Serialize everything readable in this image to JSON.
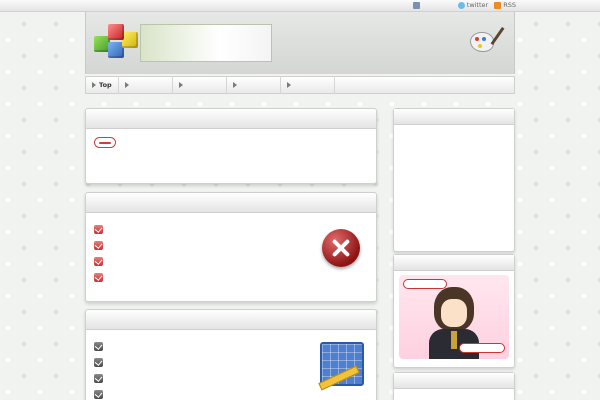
{
  "toplinks": {
    "home": "",
    "twitter": "twitter",
    "rss": "RSS"
  },
  "header": {
    "tagline": "",
    "title": "",
    "subtitle": ""
  },
  "nav": [
    {
      "label": "Top"
    },
    {
      "label": ""
    },
    {
      "label": ""
    },
    {
      "label": ""
    },
    {
      "label": ""
    }
  ],
  "panel_intro": {
    "title": "",
    "text": "",
    "link": ""
  },
  "panel_mistakes": {
    "title": "",
    "items": [
      "",
      "",
      "",
      ""
    ]
  },
  "panel_lessons": {
    "title": "",
    "items": [
      "",
      "",
      "",
      ""
    ]
  },
  "sidebar": {
    "box1_title": "",
    "box2_title": "",
    "box2_caption": "",
    "box3_title": ""
  },
  "colors": {
    "accent_red": "#c73030",
    "link_blue": "#1b3f9c"
  }
}
